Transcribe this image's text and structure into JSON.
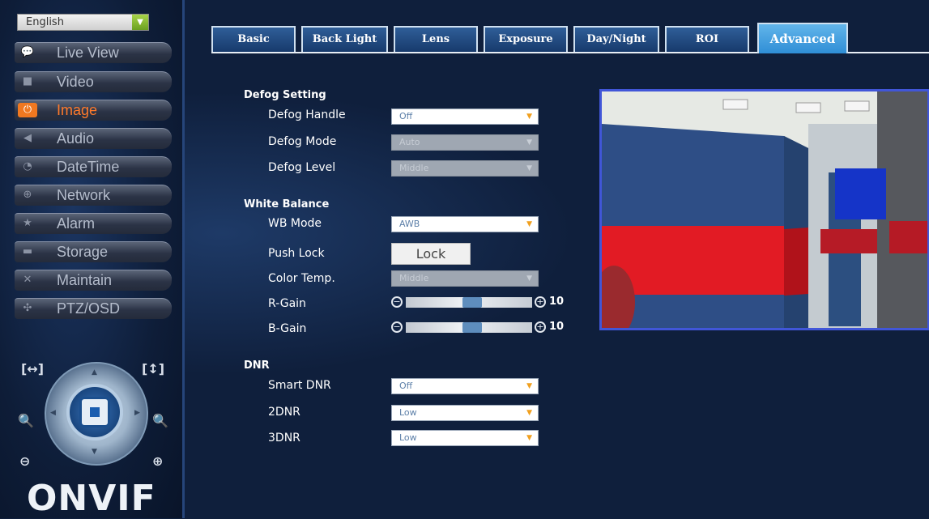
{
  "language": {
    "selected": "English"
  },
  "sidebar": {
    "items": [
      {
        "label": "Live View",
        "icon": "chat-bubble-icon"
      },
      {
        "label": "Video",
        "icon": "camera-icon"
      },
      {
        "label": "Image",
        "icon": "power-icon",
        "active": true
      },
      {
        "label": "Audio",
        "icon": "speaker-icon"
      },
      {
        "label": "DateTime",
        "icon": "clock-icon"
      },
      {
        "label": "Network",
        "icon": "globe-icon"
      },
      {
        "label": "Alarm",
        "icon": "star-icon"
      },
      {
        "label": "Storage",
        "icon": "drive-icon"
      },
      {
        "label": "Maintain",
        "icon": "tools-icon"
      },
      {
        "label": "PTZ/OSD",
        "icon": "ptz-icon"
      }
    ],
    "logo": "ONVIF"
  },
  "tabs": [
    {
      "label": "Basic"
    },
    {
      "label": "Back Light"
    },
    {
      "label": "Lens"
    },
    {
      "label": "Exposure"
    },
    {
      "label": "Day/Night"
    },
    {
      "label": "ROI"
    },
    {
      "label": "Advanced",
      "active": true
    }
  ],
  "defog": {
    "title": "Defog Setting",
    "handle_label": "Defog Handle",
    "handle_value": "Off",
    "mode_label": "Defog Mode",
    "mode_value": "Auto",
    "level_label": "Defog Level",
    "level_value": "Middle"
  },
  "wb": {
    "title": "White Balance",
    "mode_label": "WB Mode",
    "mode_value": "AWB",
    "push_label": "Push Lock",
    "push_button": "Lock",
    "temp_label": "Color Temp.",
    "temp_value": "Middle",
    "rgain_label": "R-Gain",
    "rgain_value": "10",
    "bgain_label": "B-Gain",
    "bgain_value": "10"
  },
  "dnr": {
    "title": "DNR",
    "smart_label": "Smart DNR",
    "smart_value": "Off",
    "d2_label": "2DNR",
    "d2_value": "Low",
    "d3_label": "3DNR",
    "d3_value": "Low"
  },
  "colors": {
    "active_nav": "#f07820",
    "active_tab": "#3fa0e0",
    "preview_border": "#4156d8"
  }
}
